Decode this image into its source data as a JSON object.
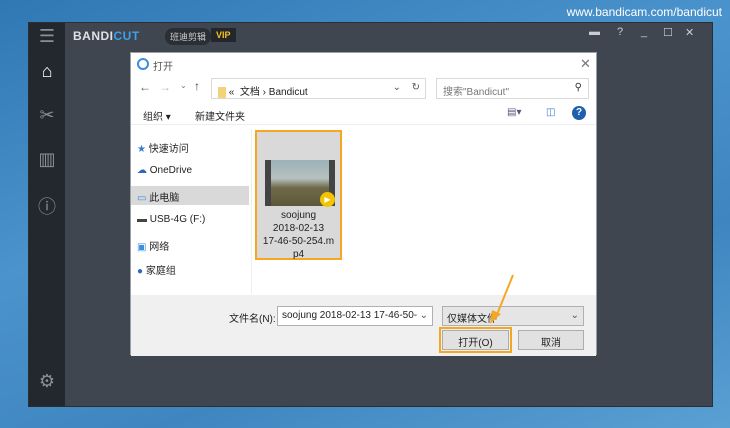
{
  "watermark": "www.bandicam.com/bandicut",
  "app": {
    "logo_a": "BANDI",
    "logo_b": "CUT",
    "logo_cn": "班迪剪辑",
    "vip": "VIP",
    "controls": {
      "folder": "▬",
      "help": "?",
      "min": "_",
      "max": "☐",
      "close": "✕"
    }
  },
  "dialog": {
    "title": "打开",
    "address": {
      "prefix": "«",
      "segments": [
        "文档",
        "Bandicut"
      ]
    },
    "search_placeholder": "搜索\"Bandicut\"",
    "toolbar": {
      "organize": "组织 ▾",
      "new_folder": "新建文件夹"
    },
    "nav": [
      "快速访问",
      "OneDrive",
      "此电脑",
      "USB-4G (F:)",
      "网络",
      "家庭组"
    ],
    "file": {
      "lines": [
        "soojung",
        "2018-02-13",
        "17-46-50-254.m",
        "p4"
      ]
    },
    "filename_label": "文件名(N):",
    "filename_value": "soojung 2018-02-13 17-46-50-",
    "filter": "仅媒体文件",
    "open": "打开(O)",
    "cancel": "取消"
  }
}
